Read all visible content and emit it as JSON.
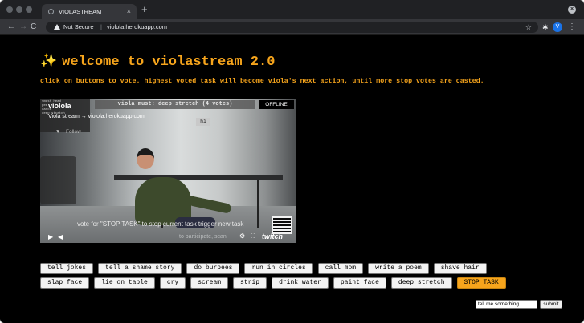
{
  "browser": {
    "tab_title": "VIOLASTREAM",
    "tab_close": "×",
    "new_tab": "+",
    "security_label": "Not Secure",
    "separator": "|",
    "url": "violola.herokuapp.com",
    "avatar_letter": "V"
  },
  "page": {
    "headline_icon": "✨",
    "headline": "welcome to violastream 2.0",
    "subline": "click on buttons to vote. highest voted task will become viola's next action, until more stop votes are casted."
  },
  "video": {
    "chat_lines": [
      "smash head",
      "pee",
      "dance",
      "deep stretch"
    ],
    "channel": "violola",
    "stream_link": "Viola stream → violola.herokuapp.com",
    "follow_label": "Follow",
    "banner": "viola must: deep stretch (4 votes)",
    "status": "OFFLINE",
    "chat_bubble": "hi",
    "vote_hint": "vote for \"STOP TASK\" to stop current task trigger new task",
    "participate_hint": "to participate, scan",
    "twitch_label": "twitch"
  },
  "votes": {
    "row1": [
      "tell jokes",
      "tell a shame story",
      "do burpees",
      "run in circles",
      "call mom",
      "write a poem",
      "shave hair"
    ],
    "row2": [
      "slap face",
      "lie on table",
      "cry",
      "scream",
      "strip",
      "drink water",
      "paint face",
      "deep stretch",
      "STOP TASK"
    ]
  },
  "suggest": {
    "value": "tell me something",
    "submit_label": "submit"
  },
  "colors": {
    "accent": "#f7a51c",
    "page_bg": "#000000"
  }
}
